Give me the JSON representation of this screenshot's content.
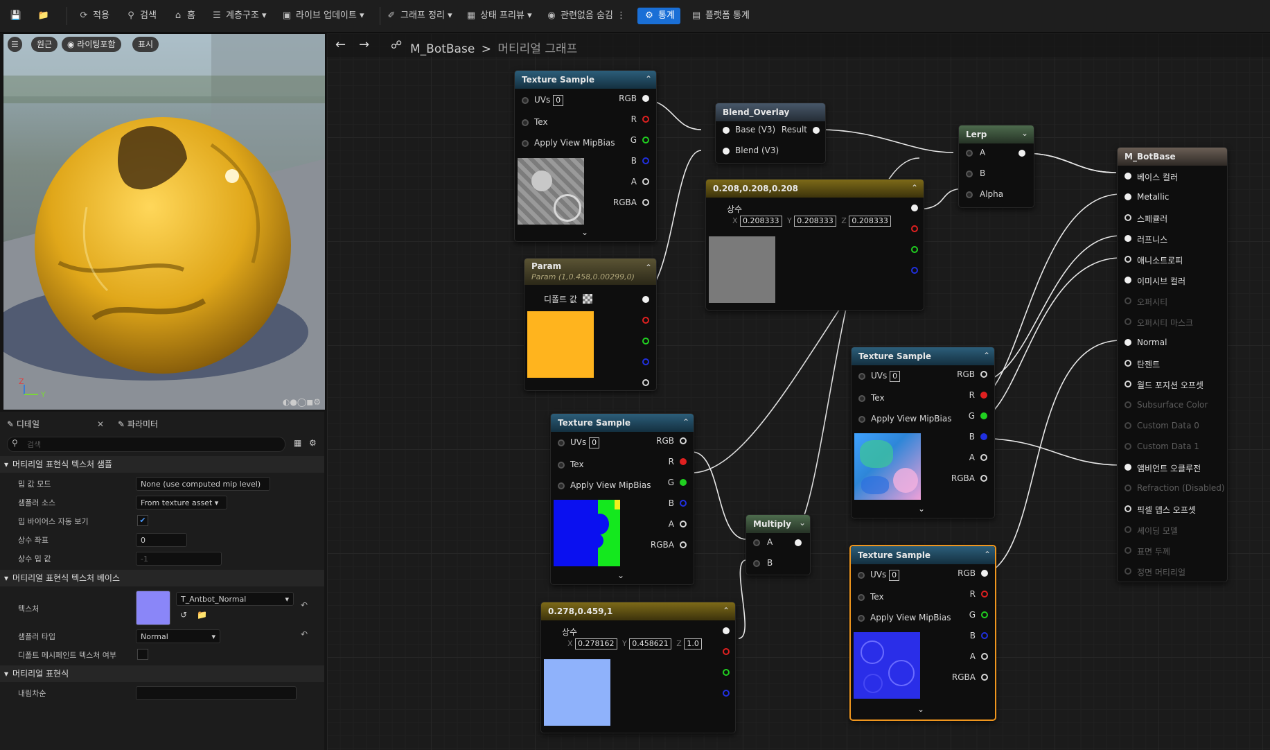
{
  "toolbar": {
    "items": [
      "적용",
      "검색",
      "홈",
      "계층구조",
      "라이브 업데이트",
      "그래프 정리",
      "상태 프리뷰",
      "관련없음 숨김",
      "통계",
      "플랫폼 통계"
    ]
  },
  "viewport": {
    "pills": [
      "원근",
      "라이팅포함",
      "표시"
    ]
  },
  "details": {
    "tab_details": "디테일",
    "tab_params": "파라미터",
    "search_placeholder": "검색",
    "sections": [
      "머티리얼 표현식 텍스처 샘플",
      "머티리얼 표현식 텍스처 베이스",
      "머티리얼 표현식"
    ],
    "rows": {
      "mip_mode_label": "밉 값 모드",
      "mip_mode_value": "None (use computed mip level)",
      "sampler_source_label": "샘플러 소스",
      "sampler_source_value": "From texture asset",
      "auto_mipbias_label": "밉 바이어스 자동 보기",
      "const_coord_label": "상수 좌표",
      "const_coord_value": "0",
      "const_mip_label": "상수 밉 값",
      "const_mip_value": "-1",
      "texture_label": "텍스처",
      "texture_value": "T_Antbot_Normal",
      "sampler_type_label": "샘플러 타입",
      "sampler_type_value": "Normal",
      "default_mesh_label": "디폴트 메시페인트 텍스처 여부",
      "desc_label": "내림차순"
    }
  },
  "breadcrumb": {
    "asset": "M_BotBase",
    "separator": ">",
    "graph": "머티리얼 그래프"
  },
  "nodes": {
    "ts_label": "Texture Sample",
    "uvs_label": "UVs",
    "uvs_value": "0",
    "tex_label": "Tex",
    "mipbias_label": "Apply View MipBias",
    "out_rgb": "RGB",
    "out_r": "R",
    "out_g": "G",
    "out_b": "B",
    "out_a": "A",
    "out_rgba": "RGBA",
    "blend_title": "Blend_Overlay",
    "blend_base": "Base (V3)",
    "blend_result": "Result",
    "blend_blend": "Blend (V3)",
    "lerp_title": "Lerp",
    "lerp_a": "A",
    "lerp_b": "B",
    "lerp_alpha": "Alpha",
    "const1_title": "0.208,0.208,0.208",
    "const_label": "상수",
    "const1_x": "0.208333",
    "const1_y": "0.208333",
    "const1_z": "0.208333",
    "param_title": "Param",
    "param_sub": "Param (1,0.458,0.00299,0)",
    "param_default": "디폴트 값",
    "multiply_title": "Multiply",
    "mul_a": "A",
    "mul_b": "B",
    "const2_title": "0.278,0.459,1",
    "const2_x": "0.278162",
    "const2_y": "0.458621",
    "const2_z": "1.0",
    "axis_x": "X",
    "axis_y": "Y",
    "axis_z": "Z",
    "result_title": "M_BotBase",
    "result_pins": [
      "베이스 컬러",
      "Metallic",
      "스페큘러",
      "러프니스",
      "애니소트로피",
      "이미시브 컬러",
      "오퍼시티",
      "오퍼시티 마스크",
      "Normal",
      "탄젠트",
      "월드 포지션 오프셋",
      "Subsurface Color",
      "Custom Data 0",
      "Custom Data 1",
      "앰비언트 오클루전",
      "Refraction (Disabled)",
      "픽셀 뎁스 오프셋",
      "셰이딩 모델",
      "표면 두께",
      "정면 머티리얼"
    ],
    "result_disabled": [
      false,
      false,
      false,
      false,
      false,
      false,
      true,
      true,
      false,
      false,
      false,
      true,
      true,
      true,
      false,
      true,
      false,
      true,
      true,
      true
    ]
  },
  "colors": {
    "accent": "#1a6fd6",
    "param_color": "#ffb41e",
    "const1_color": "#7a7a7a",
    "const2_color": "#8fb2fb",
    "selected_border": "#f0961e"
  }
}
